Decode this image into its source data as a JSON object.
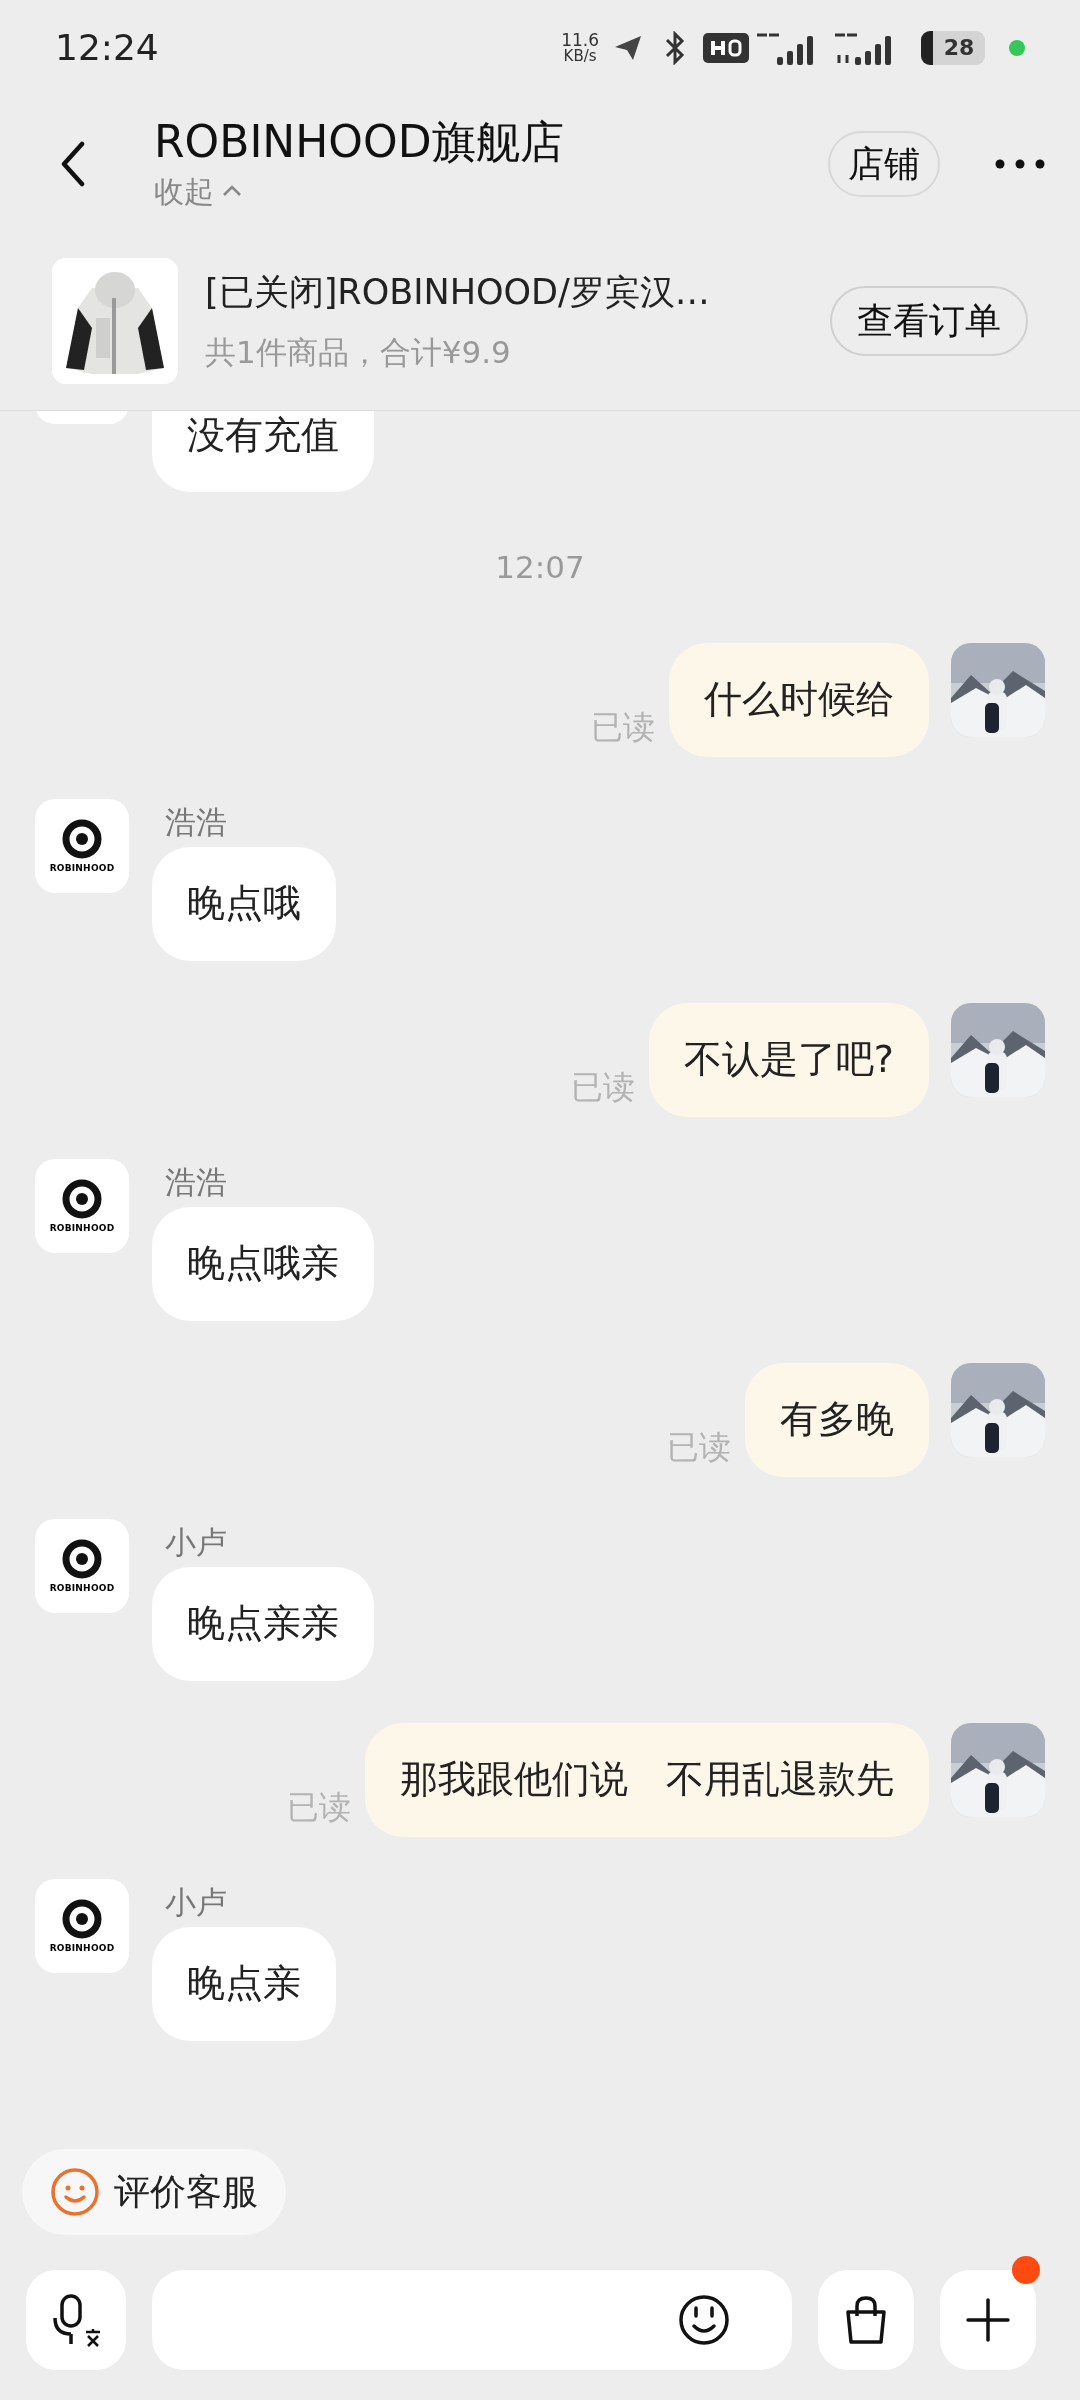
{
  "status_bar": {
    "time": "12:24",
    "speed": "11.6",
    "speed_unit": "KB/s",
    "battery": "28"
  },
  "header": {
    "title": "ROBINHOOD旗舰店",
    "collapse": "收起",
    "shop_button": "店铺"
  },
  "order": {
    "title": "[已关闭]ROBINHOOD/罗宾汉…",
    "summary": "共1件商品，合计¥9.9",
    "button": "查看订单"
  },
  "messages": [
    {
      "kind": "incoming",
      "text": "没有充值"
    },
    {
      "kind": "time",
      "text": "12:07"
    },
    {
      "kind": "outgoing",
      "text": "什么时候给",
      "status": "已读"
    },
    {
      "kind": "incoming",
      "sender": "浩浩",
      "avatar_text": "ROBINHOOD",
      "text": "晚点哦"
    },
    {
      "kind": "outgoing",
      "text": "不认是了吧?",
      "status": "已读"
    },
    {
      "kind": "incoming",
      "sender": "浩浩",
      "avatar_text": "ROBINHOOD",
      "text": "晚点哦亲"
    },
    {
      "kind": "outgoing",
      "text": "有多晚",
      "status": "已读"
    },
    {
      "kind": "incoming",
      "sender": "小卢",
      "avatar_text": "ROBINHOOD",
      "text": "晚点亲亲"
    },
    {
      "kind": "outgoing",
      "text": "那我跟他们说　不用乱退款先",
      "status": "已读"
    },
    {
      "kind": "incoming",
      "sender": "小卢",
      "avatar_text": "ROBINHOOD",
      "text": "晚点亲"
    }
  ],
  "rate_chip": "评价客服",
  "input_bar": {
    "plus_badge": true
  }
}
